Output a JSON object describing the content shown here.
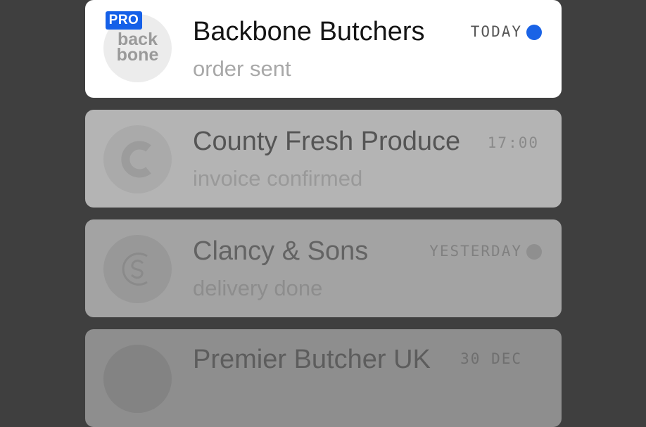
{
  "conversations": [
    {
      "name": "Backbone Butchers",
      "status": "order sent",
      "timestamp": "TODAY",
      "badge": "PRO",
      "logo_text": "back bone",
      "unread_dot_color": "#1a63e6"
    },
    {
      "name": "County Fresh Produce",
      "status": "invoice confirmed",
      "timestamp": "17:00",
      "avatar_icon": "c-logo-icon"
    },
    {
      "name": "Clancy & Sons",
      "status": "delivery done",
      "timestamp": "YESTERDAY",
      "avatar_icon": "cs-monogram-icon",
      "read_dot_color": "#8f8f8f"
    },
    {
      "name": "Premier Butcher UK",
      "timestamp": "30 DEC"
    }
  ],
  "colors": {
    "background": "#3f3f3f",
    "accent": "#1560e8"
  }
}
